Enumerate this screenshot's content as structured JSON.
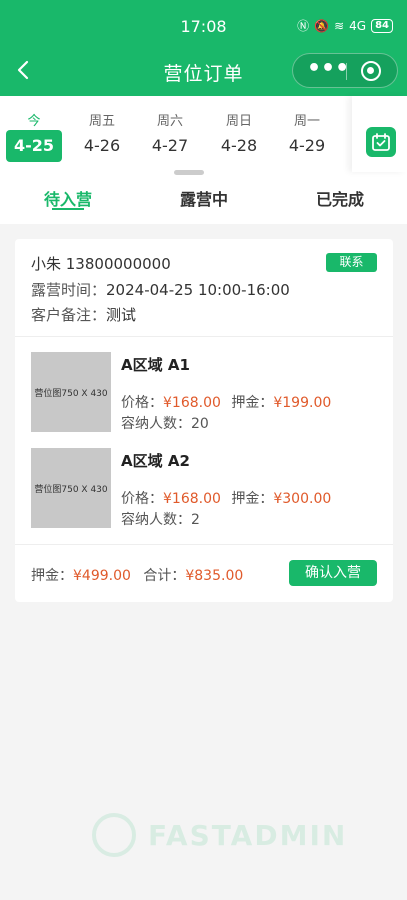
{
  "status_bar": {
    "time": "17:08",
    "signal": "4G",
    "battery": "84"
  },
  "navbar": {
    "title": "营位订单",
    "more_icon": "more-dots-icon",
    "target_icon": "target-icon"
  },
  "dates": [
    {
      "weekday": "今",
      "date": "4-25",
      "active": true
    },
    {
      "weekday": "周五",
      "date": "4-26"
    },
    {
      "weekday": "周六",
      "date": "4-27"
    },
    {
      "weekday": "周日",
      "date": "4-28"
    },
    {
      "weekday": "周一",
      "date": "4-29"
    }
  ],
  "tabs": [
    {
      "label": "待入营",
      "active": true
    },
    {
      "label": "露营中"
    },
    {
      "label": "已完成"
    }
  ],
  "order": {
    "customer": "小朱 13800000000",
    "contact_label": "联系",
    "time_label": "露营时间：",
    "time_value": "2024-04-25 10:00-16:00",
    "note_label": "客户备注：",
    "note_value": "测试",
    "items": [
      {
        "thumb_text": "营位图750 X 430",
        "name": "A区域 A1",
        "price_label": "价格：",
        "price": "¥168.00",
        "deposit_label": "押金：",
        "deposit": "¥199.00",
        "capacity_label": "容纳人数：",
        "capacity": "20"
      },
      {
        "thumb_text": "营位图750 X 430",
        "name": "A区域 A2",
        "price_label": "价格：",
        "price": "¥168.00",
        "deposit_label": "押金：",
        "deposit": "¥300.00",
        "capacity_label": "容纳人数：",
        "capacity": "2"
      }
    ],
    "total_deposit_label": "押金：",
    "total_deposit": "¥499.00",
    "total_label": "合计：",
    "total": "¥835.00",
    "confirm_label": "确认入营"
  },
  "watermark": {
    "text": "FASTADMIN"
  },
  "colors": {
    "primary": "#19b86a",
    "price": "#e05a2b",
    "background": "#f4f4f4"
  }
}
